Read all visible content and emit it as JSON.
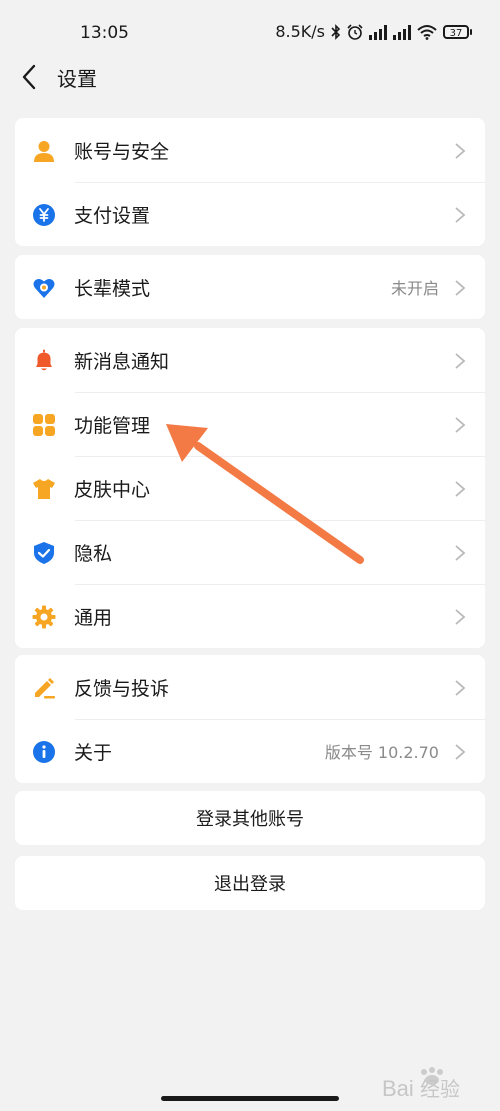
{
  "status_bar": {
    "time": "13:05",
    "net_speed": "8.5K/s",
    "battery": "37"
  },
  "header": {
    "title": "设置"
  },
  "groups": [
    {
      "items": [
        {
          "label": "账号与安全",
          "value": ""
        },
        {
          "label": "支付设置",
          "value": ""
        }
      ]
    },
    {
      "items": [
        {
          "label": "长辈模式",
          "value": "未开启"
        }
      ]
    },
    {
      "items": [
        {
          "label": "新消息通知",
          "value": ""
        },
        {
          "label": "功能管理",
          "value": ""
        },
        {
          "label": "皮肤中心",
          "value": ""
        },
        {
          "label": "隐私",
          "value": ""
        },
        {
          "label": "通用",
          "value": ""
        }
      ]
    },
    {
      "items": [
        {
          "label": "反馈与投诉",
          "value": ""
        },
        {
          "label": "关于",
          "value": "版本号 10.2.70"
        }
      ]
    }
  ],
  "buttons": {
    "switch_account": "登录其他账号",
    "logout": "退出登录"
  },
  "watermark": {
    "text": "Bai经验"
  },
  "colors": {
    "accent_orange": "#f6a623",
    "bell_red": "#f05a2a",
    "blue": "#1a73e8",
    "arrow": "#f47a45"
  }
}
